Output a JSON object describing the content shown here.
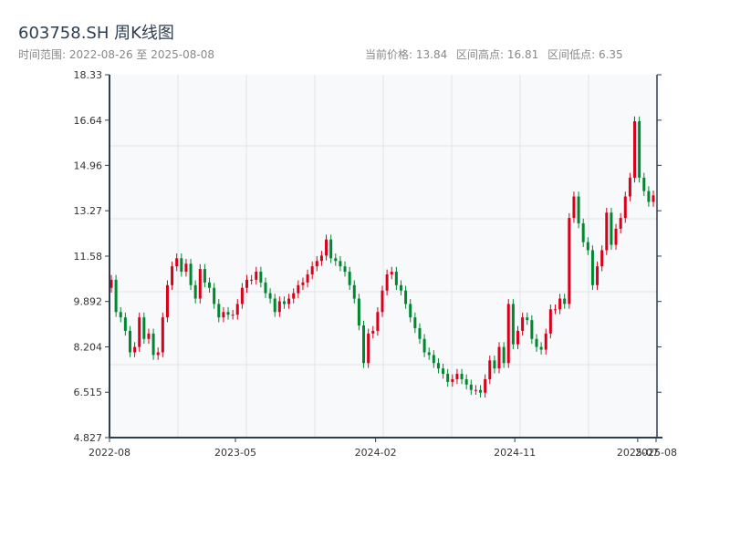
{
  "header": {
    "title": "603758.SH 周K线图",
    "range": "时间范围: 2022-08-26 至 2025-08-08",
    "current": "当前价格: 13.84",
    "high": "区间高点: 16.81",
    "low": "区间低点: 6.35"
  },
  "colors": {
    "up": "#d9001b",
    "down": "#00872f",
    "axis": "#2c3e50",
    "grid": "#e0e4ea",
    "plot_bg": "#f7f9fb"
  },
  "chart_data": {
    "type": "candlestick",
    "title": "603758.SH 周K线图",
    "ylim": [
      4.827,
      18.33
    ],
    "yticks": [
      "18.33",
      "16.64",
      "14.96",
      "13.27",
      "11.58",
      "9.892",
      "8.204",
      "6.515",
      "4.827"
    ],
    "ytick_values": [
      18.33,
      16.64,
      14.96,
      13.27,
      11.58,
      9.892,
      8.204,
      6.515,
      4.827
    ],
    "xlim": [
      "2022-08-26",
      "2025-08-08"
    ],
    "xticks": [
      {
        "label": "2022-08",
        "date": "2022-08-26"
      },
      {
        "label": "2023-05",
        "date": "2023-05-01"
      },
      {
        "label": "2024-02",
        "date": "2024-02-01"
      },
      {
        "label": "2024-11",
        "date": "2024-11-01"
      },
      {
        "label": "2025-07",
        "date": "2025-07-01"
      },
      {
        "label": "2025-08",
        "date": "2025-08-08"
      }
    ],
    "first_open": 10.4,
    "closes": [
      10.7,
      9.5,
      9.3,
      8.8,
      8.0,
      8.2,
      9.3,
      8.5,
      8.7,
      7.9,
      8.0,
      9.3,
      10.5,
      11.2,
      11.5,
      11.0,
      11.3,
      10.5,
      10.0,
      11.1,
      10.6,
      10.4,
      9.8,
      9.3,
      9.5,
      9.4,
      9.4,
      9.8,
      10.4,
      10.7,
      10.7,
      11.0,
      10.6,
      10.2,
      10.0,
      9.5,
      9.9,
      9.8,
      10.0,
      10.2,
      10.5,
      10.6,
      10.9,
      11.2,
      11.4,
      11.6,
      12.2,
      11.5,
      11.4,
      11.2,
      11.0,
      10.5,
      10.0,
      9.0,
      7.6,
      8.7,
      8.8,
      9.5,
      10.3,
      10.9,
      11.0,
      10.5,
      10.3,
      9.8,
      9.3,
      8.9,
      8.5,
      8.0,
      7.9,
      7.6,
      7.4,
      7.2,
      6.9,
      7.0,
      7.2,
      7.0,
      6.8,
      6.6,
      6.6,
      6.5,
      7.0,
      7.7,
      7.4,
      8.2,
      7.6,
      9.8,
      8.3,
      8.8,
      9.3,
      9.2,
      8.5,
      8.2,
      8.1,
      8.7,
      9.6,
      9.6,
      10.0,
      9.8,
      13.0,
      13.8,
      12.8,
      12.1,
      11.8,
      10.5,
      11.2,
      11.8,
      13.2,
      12.0,
      12.6,
      13.0,
      13.8,
      14.5,
      16.6,
      14.5,
      14.0,
      13.6,
      13.84
    ]
  }
}
